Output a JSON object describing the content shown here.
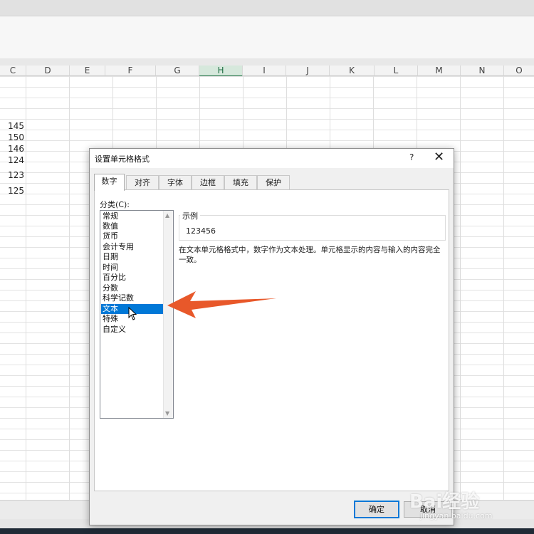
{
  "columns": [
    "C",
    "D",
    "E",
    "F",
    "G",
    "H",
    "I",
    "J",
    "K",
    "L",
    "M",
    "N",
    "O"
  ],
  "active_column": "H",
  "cells_c": [
    "145",
    "150",
    "146",
    "124",
    "123",
    "125"
  ],
  "dialog": {
    "title": "设置单元格格式",
    "help": "?",
    "close": "✕",
    "tabs": [
      "数字",
      "对齐",
      "字体",
      "边框",
      "填充",
      "保护"
    ],
    "selected_tab": "数字",
    "category_label": "分类(C):",
    "categories": [
      "常规",
      "数值",
      "货币",
      "会计专用",
      "日期",
      "时间",
      "百分比",
      "分数",
      "科学记数",
      "文本",
      "特殊",
      "自定义"
    ],
    "selected_category": "文本",
    "sample_label": "示例",
    "sample_value": "123456",
    "description": "在文本单元格格式中，数字作为文本处理。单元格显示的内容与输入的内容完全一致。",
    "ok": "确定",
    "cancel": "取消"
  },
  "watermark": {
    "brand": "Bai经验",
    "url": "jingyan.baidu.com"
  },
  "colors": {
    "accent": "#0078d7",
    "arrow": "#e8582a",
    "excel_green": "#217346"
  }
}
